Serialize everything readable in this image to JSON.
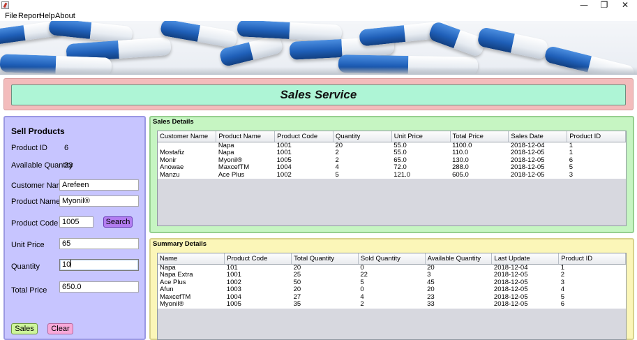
{
  "window": {
    "minimize_glyph": "—",
    "restore_glyph": "❐",
    "close_glyph": "✕"
  },
  "menu": [
    "File",
    "Report",
    "Help",
    "About"
  ],
  "header": {
    "title": "Sales Service"
  },
  "sell_products": {
    "title": "Sell Products",
    "product_id_label": "Product ID",
    "product_id_value": "6",
    "available_quantity_label": "Available Quantity",
    "available_quantity_value": "33",
    "customer_name_label": "Customer Name",
    "customer_name_value": "Arefeen",
    "product_name_label": "Product Name",
    "product_name_value": "Myonil®",
    "product_code_label": "Product Code",
    "product_code_value": "1005",
    "search_button": "Search",
    "unit_price_label": "Unit Price",
    "unit_price_value": "65",
    "quantity_label": "Quantity",
    "quantity_value": "10",
    "total_price_label": "Total Price",
    "total_price_value": "650.0",
    "sales_button": "Sales",
    "clear_button": "Clear"
  },
  "sales_details": {
    "title": "Sales Details",
    "columns": [
      "Customer Name",
      "Product Name",
      "Product Code",
      "Quantity",
      "Unit Price",
      "Total Price",
      "Sales Date",
      "Product ID"
    ],
    "rows": [
      [
        "",
        "Napa",
        "1001",
        "20",
        "55.0",
        "1100.0",
        "2018-12-04",
        "1"
      ],
      [
        "Mostafiz",
        "Napa",
        "1001",
        "2",
        "55.0",
        "110.0",
        "2018-12-05",
        "1"
      ],
      [
        "Monir",
        "Myonil®",
        "1005",
        "2",
        "65.0",
        "130.0",
        "2018-12-05",
        "6"
      ],
      [
        "Anowae",
        "MaxcefTM",
        "1004",
        "4",
        "72.0",
        "288.0",
        "2018-12-05",
        "5"
      ],
      [
        "Manzu",
        "Ace Plus",
        "1002",
        "5",
        "121.0",
        "605.0",
        "2018-12-05",
        "3"
      ]
    ]
  },
  "summary_details": {
    "title": "Summary Details",
    "columns": [
      "Name",
      "Product Code",
      "Total Quantity",
      "Sold Quantity",
      "Available Quantity",
      "Last Update",
      "Product ID"
    ],
    "rows": [
      [
        "Napa",
        "101",
        "20",
        "0",
        "20",
        "2018-12-04",
        "1"
      ],
      [
        "Napa Extra",
        "1001",
        "25",
        "22",
        "3",
        "2018-12-05",
        "2"
      ],
      [
        "Ace Plus",
        "1002",
        "50",
        "5",
        "45",
        "2018-12-05",
        "3"
      ],
      [
        "Afun",
        "1003",
        "20",
        "0",
        "20",
        "2018-12-05",
        "4"
      ],
      [
        "MaxcefTM",
        "1004",
        "27",
        "4",
        "23",
        "2018-12-05",
        "5"
      ],
      [
        "Myonil®",
        "1005",
        "35",
        "2",
        "33",
        "2018-12-05",
        "6"
      ]
    ]
  },
  "colors": {
    "header_outer": "#f3bcbc",
    "header_inner": "#aef5d6",
    "sell_panel": "#c7c5ff",
    "sales_panel": "#c6f5c2",
    "summary_panel": "#fbf6b8",
    "search_button": "#b27cf0",
    "sales_button": "#cdf59a",
    "clear_button": "#f7a8d8"
  }
}
